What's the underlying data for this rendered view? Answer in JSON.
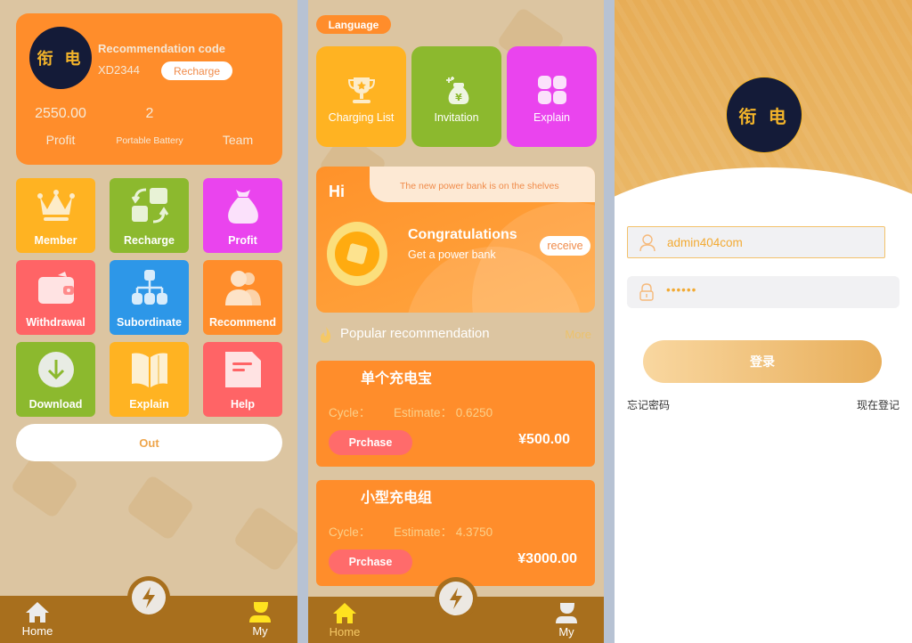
{
  "panel_home_my": {
    "logo_text": "衔 电",
    "recommendation_code_label": "Recommendation code",
    "recommendation_code": "XD2344",
    "recharge_button": "Recharge",
    "stats": [
      {
        "value": "2550.00",
        "label": "Profit"
      },
      {
        "value": "2",
        "label": "Portable Battery"
      },
      {
        "value": "",
        "label": "Team"
      }
    ],
    "menu": [
      {
        "label": "Member",
        "icon": "crown-icon",
        "color": "#ffb322"
      },
      {
        "label": "Recharge",
        "icon": "exchange-icon",
        "color": "#8cb92e"
      },
      {
        "label": "Profit",
        "icon": "money-bag-icon",
        "color": "#ea44ee"
      },
      {
        "label": "Withdrawal",
        "icon": "wallet-icon",
        "color": "#ff6466"
      },
      {
        "label": "Subordinate",
        "icon": "hierarchy-icon",
        "color": "#2d97e8"
      },
      {
        "label": "Recommend",
        "icon": "users-icon",
        "color": "#ff8d2b"
      },
      {
        "label": "Download",
        "icon": "download-icon",
        "color": "#8cb92e"
      },
      {
        "label": "Explain",
        "icon": "book-icon",
        "color": "#ffb322"
      },
      {
        "label": "Help",
        "icon": "document-icon",
        "color": "#ff6466"
      }
    ],
    "out_button": "Out",
    "tabbar": {
      "home": "Home",
      "my": "My",
      "active": "my"
    }
  },
  "panel_home": {
    "language_button": "Language",
    "quick_links": [
      {
        "label": "Charging List",
        "icon": "trophy-icon",
        "color": "#ffb322"
      },
      {
        "label": "Invitation",
        "icon": "money-bag-yen-icon",
        "color": "#8cb92e"
      },
      {
        "label": "Explain",
        "icon": "grid-icon",
        "color": "#ea44ee"
      }
    ],
    "promo": {
      "greeting": "Hi",
      "banner_text": "The new power bank is on the shelves",
      "title": "Congratulations",
      "subtitle": "Get a power bank",
      "receive_button": "receive"
    },
    "popular_title": "Popular recommendation",
    "more_link": "More",
    "products": [
      {
        "name": "单个充电宝",
        "cycle_label": "Cycle：",
        "estimate_label": "Estimate：",
        "estimate": "0.6250",
        "buy_button": "Prchase",
        "price": "¥500.00"
      },
      {
        "name": "小型充电组",
        "cycle_label": "Cycle：",
        "estimate_label": "Estimate：",
        "estimate": "4.3750",
        "buy_button": "Prchase",
        "price": "¥3000.00"
      }
    ],
    "tabbar": {
      "home": "Home",
      "my": "My",
      "active": "home"
    }
  },
  "panel_login": {
    "logo_text": "衔 电",
    "username_value": "admin404com",
    "password_value": "••••••",
    "login_button": "登录",
    "forgot_password": "忘记密码",
    "register": "现在登记"
  },
  "colors": {
    "accent_orange": "#ff8d2b",
    "tabbar_brown": "#a86f1d",
    "active_tab_yellow": "#ffe21f",
    "background_beige": "#dcc5a1"
  }
}
